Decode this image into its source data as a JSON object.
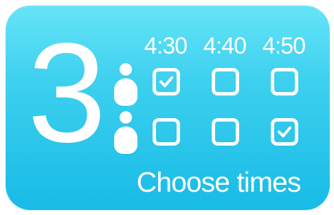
{
  "card": {
    "step_number": "3",
    "footer_text": "Choose times",
    "times": [
      "4:30",
      "4:40",
      "4:50"
    ],
    "rows": [
      {
        "participant_icon": "person-icon",
        "selected": [
          true,
          false,
          false
        ]
      },
      {
        "participant_icon": "person-icon",
        "selected": [
          false,
          false,
          true
        ]
      }
    ]
  },
  "colors": {
    "background_top": "#66e4f8",
    "background_bottom": "#17bbe6",
    "foreground": "#ffffff"
  }
}
